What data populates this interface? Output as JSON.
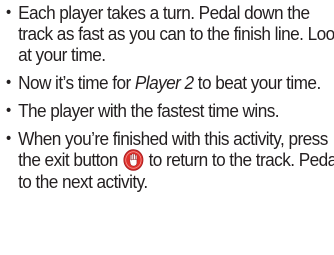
{
  "instructions": {
    "bullet_glyph": "•",
    "item1": "Each player takes a turn. Pedal down the track as fast as you can to the finish line. Look at your time.",
    "item2_before": "Now it’s time for ",
    "item2_player": "Player 2",
    "item2_after": " to beat your time.",
    "item3": "The player with the fastest time wins.",
    "item4_before": "When you’re finished with this activity, press the exit button ",
    "item4_icon": "exit-hand-icon",
    "item4_after": " to return to the track. Pedal to the next activity.",
    "colors": {
      "text": "#231f20",
      "icon_red": "#e0312b",
      "icon_dark_red": "#a41e22"
    }
  }
}
